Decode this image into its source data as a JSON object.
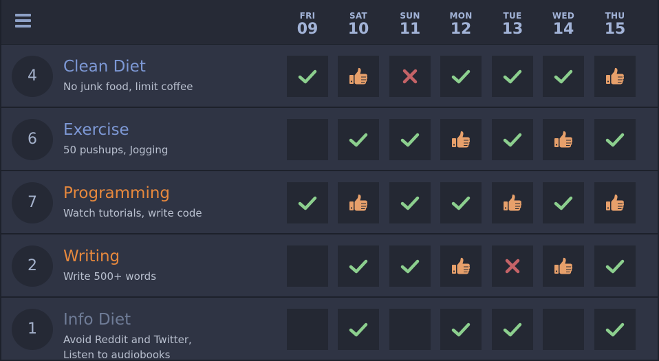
{
  "colors": {
    "check": "#8ccf8e",
    "thumb": "#e7a06b",
    "cross": "#c56367",
    "name_blue": "#7d98d5",
    "name_orange": "#e6883d",
    "name_gray": "#6f7c97"
  },
  "header": {
    "menu_icon": "hamburger-menu-icon",
    "days": [
      {
        "name": "FRI",
        "num": "09"
      },
      {
        "name": "SAT",
        "num": "10"
      },
      {
        "name": "SUN",
        "num": "11"
      },
      {
        "name": "MON",
        "num": "12"
      },
      {
        "name": "TUE",
        "num": "13"
      },
      {
        "name": "WED",
        "num": "14"
      },
      {
        "name": "THU",
        "num": "15"
      }
    ]
  },
  "habits": [
    {
      "count": "4",
      "name": "Clean Diet",
      "color": "name_blue",
      "desc": [
        "No junk food, limit coffee"
      ],
      "marks": [
        "check",
        "thumb",
        "cross",
        "check",
        "check",
        "check",
        "thumb"
      ]
    },
    {
      "count": "6",
      "name": "Exercise",
      "color": "name_blue",
      "desc": [
        "50 pushups, Jogging"
      ],
      "marks": [
        "",
        "check",
        "check",
        "thumb",
        "check",
        "thumb",
        "check"
      ]
    },
    {
      "count": "7",
      "name": "Programming",
      "color": "name_orange",
      "desc": [
        "Watch tutorials, write code"
      ],
      "marks": [
        "check",
        "thumb",
        "check",
        "check",
        "thumb",
        "check",
        "thumb"
      ]
    },
    {
      "count": "2",
      "name": "Writing",
      "color": "name_orange",
      "desc": [
        "Write 500+ words"
      ],
      "marks": [
        "",
        "check",
        "check",
        "thumb",
        "cross",
        "thumb",
        "check"
      ]
    },
    {
      "count": "1",
      "name": "Info Diet",
      "color": "name_gray",
      "desc": [
        "Avoid Reddit and Twitter,",
        "Listen to audiobooks"
      ],
      "marks": [
        "",
        "check",
        "",
        "check",
        "check",
        "",
        "check"
      ]
    }
  ]
}
